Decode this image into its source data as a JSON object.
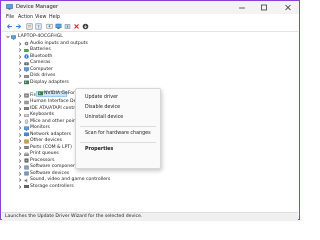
{
  "window": {
    "title": "Device Manager",
    "accent_color": "#8c3fd6"
  },
  "menu": [
    "File",
    "Action",
    "View",
    "Help"
  ],
  "toolbar": {
    "icons": [
      "back-icon",
      "forward-icon",
      "properties-icon",
      "help-icon",
      "scan-icon",
      "monitor-icon",
      "update-driver-icon",
      "remove-icon",
      "download-icon"
    ]
  },
  "tree": {
    "root": "LAPTOP-4OCGFHGL",
    "categories": [
      {
        "label": "Audio inputs and outputs",
        "icon": "audio-icon"
      },
      {
        "label": "Batteries",
        "icon": "battery-icon"
      },
      {
        "label": "Bluetooth",
        "icon": "bluetooth-icon"
      },
      {
        "label": "Cameras",
        "icon": "camera-icon"
      },
      {
        "label": "Computer",
        "icon": "computer-icon"
      },
      {
        "label": "Disk drives",
        "icon": "disk-icon"
      },
      {
        "label": "Display adapters",
        "icon": "display-adapter-icon"
      },
      {
        "label": "Firmware",
        "icon": "firmware-icon"
      },
      {
        "label": "Human Interface De",
        "icon": "hid-icon"
      },
      {
        "label": "IDE ATA/ATAPI contr",
        "icon": "ide-icon"
      },
      {
        "label": "Keyboards",
        "icon": "keyboard-icon"
      },
      {
        "label": "Mice and other poin",
        "icon": "mouse-icon"
      },
      {
        "label": "Monitors",
        "icon": "monitor-icon"
      },
      {
        "label": "Network adapters",
        "icon": "network-icon"
      },
      {
        "label": "Other devices",
        "icon": "other-device-icon"
      },
      {
        "label": "Ports (COM & LPT)",
        "icon": "port-icon"
      },
      {
        "label": "Print queues",
        "icon": "printer-icon"
      },
      {
        "label": "Processors",
        "icon": "processor-icon"
      },
      {
        "label": "Software components",
        "icon": "software-component-icon"
      },
      {
        "label": "Software devices",
        "icon": "software-device-icon"
      },
      {
        "label": "Sound, video and game controllers",
        "icon": "sound-icon"
      },
      {
        "label": "Storage controllers",
        "icon": "storage-icon"
      }
    ],
    "selected_device": "NVIDIA GeForce G"
  },
  "context_menu": {
    "items": [
      "Update driver",
      "Disable device",
      "Uninstall device",
      "Scan for hardware changes",
      "Properties"
    ]
  },
  "status_bar": {
    "text": "Launches the Update Driver Wizard for the selected device."
  }
}
